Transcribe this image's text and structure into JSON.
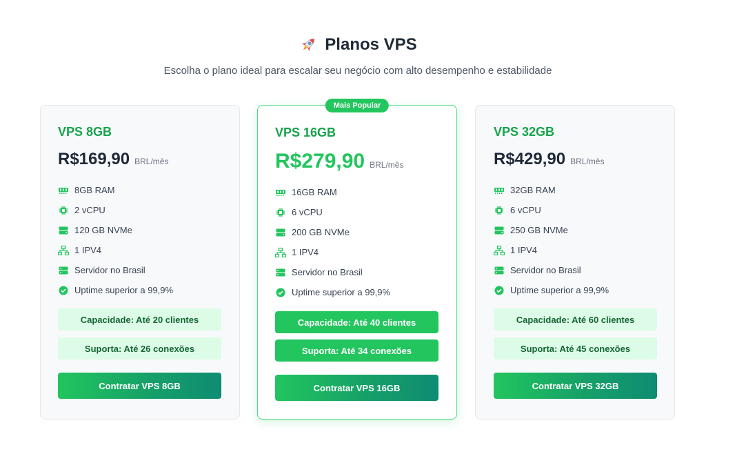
{
  "header": {
    "title": "Planos VPS",
    "title_icon": "rocket-icon",
    "subtitle": "Escolha o plano ideal para escalar seu negócio com alto desempenho e estabilidade"
  },
  "colors": {
    "accent": "#22c55e",
    "accent_dark": "#16a34a",
    "info_bg": "#dcfce7",
    "card_bg": "#f8f9fb"
  },
  "plans": [
    {
      "name": "VPS 8GB",
      "price": "R$169,90",
      "period": "BRL/mês",
      "features": [
        {
          "icon": "memory-icon",
          "label": "8GB RAM"
        },
        {
          "icon": "cpu-icon",
          "label": "2 vCPU"
        },
        {
          "icon": "storage-icon",
          "label": "120 GB NVMe"
        },
        {
          "icon": "network-icon",
          "label": "1 IPV4"
        },
        {
          "icon": "server-icon",
          "label": "Servidor no Brasil"
        },
        {
          "icon": "check-circle-icon",
          "label": "Uptime superior a 99,9%"
        }
      ],
      "capacity": "Capacidade: Até 20 clientes",
      "connections": "Suporta: Até 26 conexões",
      "cta": "Contratar VPS 8GB"
    },
    {
      "name": "VPS 16GB",
      "badge": "Mais Popular",
      "price": "R$279,90",
      "period": "BRL/mês",
      "features": [
        {
          "icon": "memory-icon",
          "label": "16GB RAM"
        },
        {
          "icon": "cpu-icon",
          "label": "6 vCPU"
        },
        {
          "icon": "storage-icon",
          "label": "200 GB NVMe"
        },
        {
          "icon": "network-icon",
          "label": "1 IPV4"
        },
        {
          "icon": "server-icon",
          "label": "Servidor no Brasil"
        },
        {
          "icon": "check-circle-icon",
          "label": "Uptime superior a 99,9%"
        }
      ],
      "capacity": "Capacidade: Até 40 clientes",
      "connections": "Suporta: Até 34 conexões",
      "cta": "Contratar VPS 16GB"
    },
    {
      "name": "VPS 32GB",
      "price": "R$429,90",
      "period": "BRL/mês",
      "features": [
        {
          "icon": "memory-icon",
          "label": "32GB RAM"
        },
        {
          "icon": "cpu-icon",
          "label": "6 vCPU"
        },
        {
          "icon": "storage-icon",
          "label": "250 GB NVMe"
        },
        {
          "icon": "network-icon",
          "label": "1 IPV4"
        },
        {
          "icon": "server-icon",
          "label": "Servidor no Brasil"
        },
        {
          "icon": "check-circle-icon",
          "label": "Uptime superior a 99,9%"
        }
      ],
      "capacity": "Capacidade: Até 60 clientes",
      "connections": "Suporta: Até 45 conexões",
      "cta": "Contratar VPS 32GB"
    }
  ]
}
